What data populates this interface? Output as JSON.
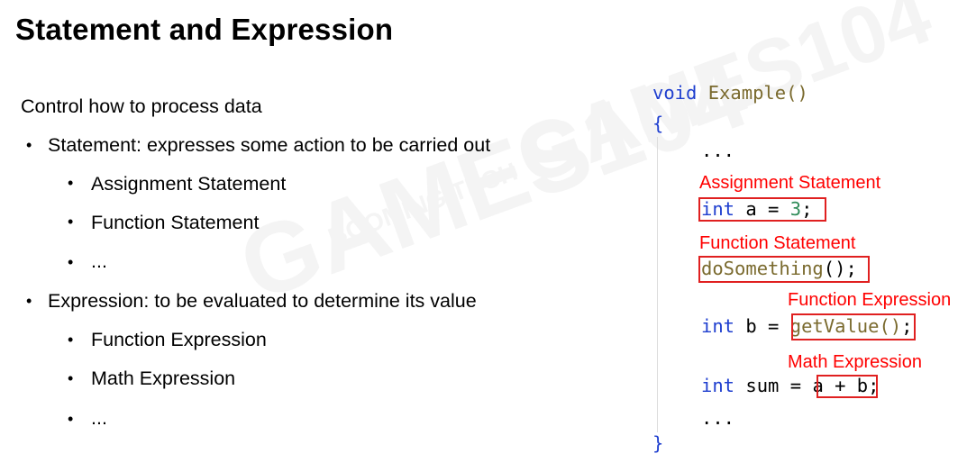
{
  "title": "Statement and Expression",
  "watermark": {
    "text": "GAMES104",
    "sub_text": "BOOMING TECH"
  },
  "left": {
    "intro": "Control how to process data",
    "items": [
      {
        "text": "Statement: expresses some action to be carried out",
        "level": 1
      },
      {
        "text": "Assignment Statement",
        "level": 2
      },
      {
        "text": "Function Statement",
        "level": 2
      },
      {
        "text": "...",
        "level": 2
      },
      {
        "text": "Expression: to be evaluated to determine its value",
        "level": 1
      },
      {
        "text": "Function Expression",
        "level": 2
      },
      {
        "text": "Math Expression",
        "level": 2
      },
      {
        "text": "...",
        "level": 2
      }
    ],
    "bullet": "•"
  },
  "code": {
    "line1_void": "void",
    "line1_name": "Example()",
    "open_brace": "{",
    "ellipsis1": "...",
    "assign_label": "Assignment Statement",
    "assign_kw": "int",
    "assign_rest": " a = ",
    "assign_num": "3",
    "assign_end": ";",
    "func_stmt_label": "Function Statement",
    "func_stmt_name": "doSomething",
    "func_stmt_end": "();",
    "func_expr_label": "Function Expression",
    "func_expr_kw": "int",
    "func_expr_rest": " b = ",
    "func_expr_call": "getValue()",
    "func_expr_end": ";",
    "math_label": "Math Expression",
    "math_kw": "int",
    "math_rest": " sum = ",
    "math_expr": "a + b",
    "math_end": ";",
    "ellipsis2": "...",
    "close_brace": "}"
  },
  "colors": {
    "keyword": "#1f3fcf",
    "function": "#7a6a2e",
    "number": "#2e8b57",
    "annotation": "#ff0000"
  }
}
